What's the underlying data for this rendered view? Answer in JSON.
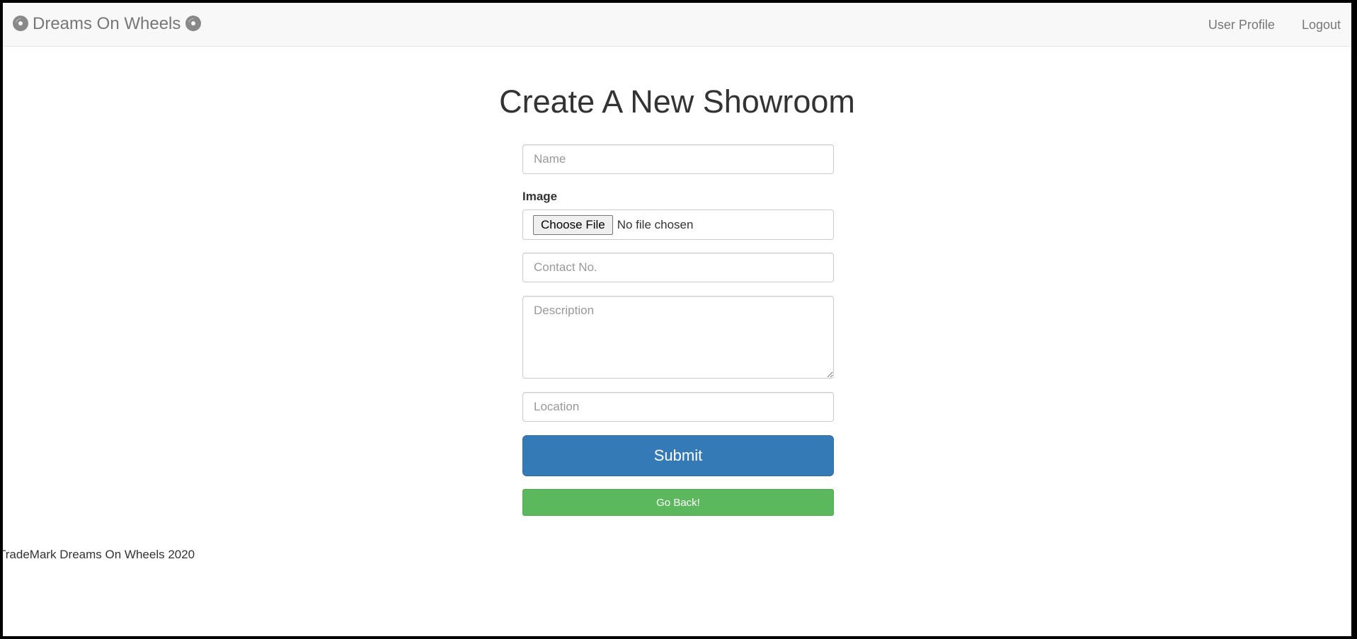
{
  "navbar": {
    "brand_label": "Dreams On Wheels",
    "brand_icon": "compact-disc-icon",
    "links": [
      {
        "label": "User Profile"
      },
      {
        "label": "Logout"
      }
    ]
  },
  "main": {
    "title": "Create A New Showroom",
    "form": {
      "name_placeholder": "Name",
      "image_label": "Image",
      "file_button_label": "Choose File",
      "file_status": "No file chosen",
      "contact_placeholder": "Contact No.",
      "description_placeholder": "Description",
      "location_placeholder": "Location",
      "submit_label": "Submit",
      "back_label": "Go Back!"
    }
  },
  "footer": {
    "text": "TradeMark Dreams On Wheels 2020"
  },
  "colors": {
    "primary": "#337ab7",
    "success": "#5cb85c",
    "navbar_bg": "#f8f8f8"
  }
}
